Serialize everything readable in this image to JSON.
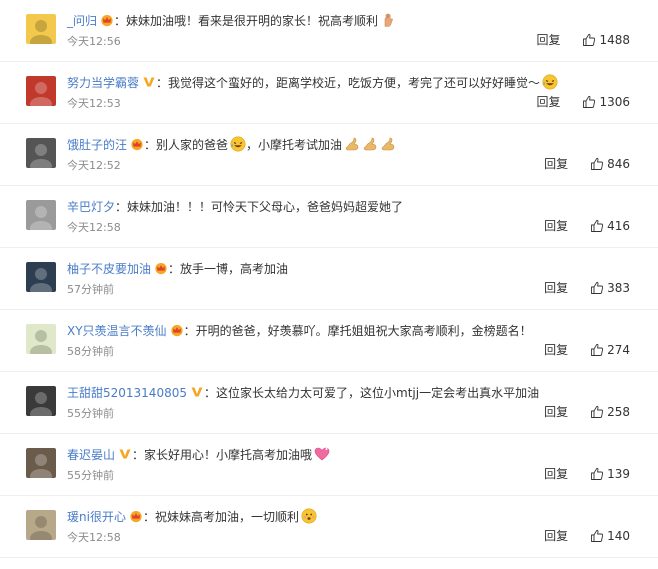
{
  "comments": [
    {
      "user": "_问归",
      "badge": "crown",
      "text": "妹妹加油哦！看来是很开明的家长！祝高考顺利",
      "emojis": [
        "raised-hand-emoji"
      ],
      "time": "今天12:56",
      "reply": "回复",
      "likes": "1488",
      "avatar_color": "#f2c94c"
    },
    {
      "user": "努力当学霸蓉",
      "badge": "vip",
      "text": "我觉得这个蛮好的，距离学校近，吃饭方便，考完了还可以好好睡觉～",
      "emojis": [
        "laughing-emoji"
      ],
      "time": "今天12:53",
      "reply": "回复",
      "likes": "1306",
      "avatar_color": "#c0392b"
    },
    {
      "user": "饿肚子的汪",
      "badge": "crown",
      "text": "别人家的爸爸",
      "emojis": [
        "laughing-emoji"
      ],
      "text2": "，小摩托考试加油",
      "emojis2": [
        "flexed-biceps-emoji",
        "flexed-biceps-emoji",
        "flexed-biceps-emoji"
      ],
      "time": "今天12:52",
      "reply": "回复",
      "likes": "846",
      "avatar_color": "#555555"
    },
    {
      "user": "辛巴灯夕",
      "badge": "",
      "text": "妹妹加油！！！可怜天下父母心，爸爸妈妈超爱她了",
      "emojis": [],
      "time": "今天12:58",
      "reply": "回复",
      "likes": "416",
      "avatar_color": "#9a9a9a"
    },
    {
      "user": "柚子不皮要加油",
      "badge": "crown",
      "text": "放手一博，高考加油",
      "emojis": [],
      "time": "57分钟前",
      "reply": "回复",
      "likes": "383",
      "avatar_color": "#2c3e50"
    },
    {
      "user": "XY只羡温言不羡仙",
      "badge": "crown",
      "text": "开明的爸爸，好羡慕吖。摩托姐姐祝大家高考顺利，金榜题名！",
      "emojis": [],
      "time": "58分钟前",
      "reply": "回复",
      "likes": "274",
      "avatar_color": "#dfe8c8"
    },
    {
      "user": "王甜甜52013140805",
      "badge": "vip",
      "text": "这位家长太给力太可爱了，这位小mtjj一定会考出真水平加油",
      "emojis": [],
      "time": "55分钟前",
      "reply": "回复",
      "likes": "258",
      "avatar_color": "#3a3a3a"
    },
    {
      "user": "春迟晏山",
      "badge": "vip",
      "text": "家长好用心！小摩托高考加油哦",
      "emojis": [
        "sparkling-heart-emoji"
      ],
      "time": "55分钟前",
      "reply": "回复",
      "likes": "139",
      "avatar_color": "#6b5b4b"
    },
    {
      "user": "瑗ni很开心",
      "badge": "crown",
      "text": "祝妹妹高考加油，一切顺利",
      "emojis": [
        "thinking-emoji"
      ],
      "time": "今天12:58",
      "reply": "回复",
      "likes": "140",
      "avatar_color": "#b8a88a"
    }
  ],
  "colors": {
    "username": "#4a7cc8",
    "time": "#8c8c8c",
    "divider": "#eceef2",
    "badge_crown": "#f5a623",
    "badge_vip": "#f5a623"
  }
}
